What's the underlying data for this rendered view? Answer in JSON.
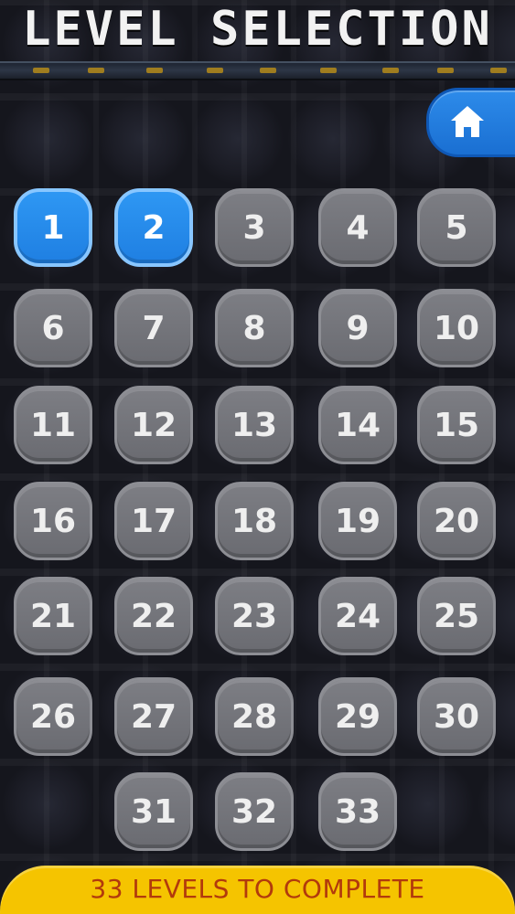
{
  "header": {
    "title": "LEVEL SELECTION"
  },
  "home_button": {
    "icon": "home-icon",
    "color": "#1f78dd"
  },
  "levels": [
    {
      "label": "1",
      "state": "unlocked"
    },
    {
      "label": "2",
      "state": "unlocked"
    },
    {
      "label": "3",
      "state": "locked"
    },
    {
      "label": "4",
      "state": "locked"
    },
    {
      "label": "5",
      "state": "locked"
    },
    {
      "label": "6",
      "state": "locked"
    },
    {
      "label": "7",
      "state": "locked"
    },
    {
      "label": "8",
      "state": "locked"
    },
    {
      "label": "9",
      "state": "locked"
    },
    {
      "label": "10",
      "state": "locked"
    },
    {
      "label": "11",
      "state": "locked"
    },
    {
      "label": "12",
      "state": "locked"
    },
    {
      "label": "13",
      "state": "locked"
    },
    {
      "label": "14",
      "state": "locked"
    },
    {
      "label": "15",
      "state": "locked"
    },
    {
      "label": "16",
      "state": "locked"
    },
    {
      "label": "17",
      "state": "locked"
    },
    {
      "label": "18",
      "state": "locked"
    },
    {
      "label": "19",
      "state": "locked"
    },
    {
      "label": "20",
      "state": "locked"
    },
    {
      "label": "21",
      "state": "locked"
    },
    {
      "label": "22",
      "state": "locked"
    },
    {
      "label": "23",
      "state": "locked"
    },
    {
      "label": "24",
      "state": "locked"
    },
    {
      "label": "25",
      "state": "locked"
    },
    {
      "label": "26",
      "state": "locked"
    },
    {
      "label": "27",
      "state": "locked"
    },
    {
      "label": "28",
      "state": "locked"
    },
    {
      "label": "29",
      "state": "locked"
    },
    {
      "label": "30",
      "state": "locked"
    },
    {
      "label": "31",
      "state": "locked"
    },
    {
      "label": "32",
      "state": "locked"
    },
    {
      "label": "33",
      "state": "locked"
    }
  ],
  "footer": {
    "text": "33 LEVELS TO COMPLETE"
  },
  "colors": {
    "unlocked": "#1f7fe2",
    "locked": "#717278",
    "footer_bg": "#f5c400",
    "footer_text": "#b23a0c"
  }
}
